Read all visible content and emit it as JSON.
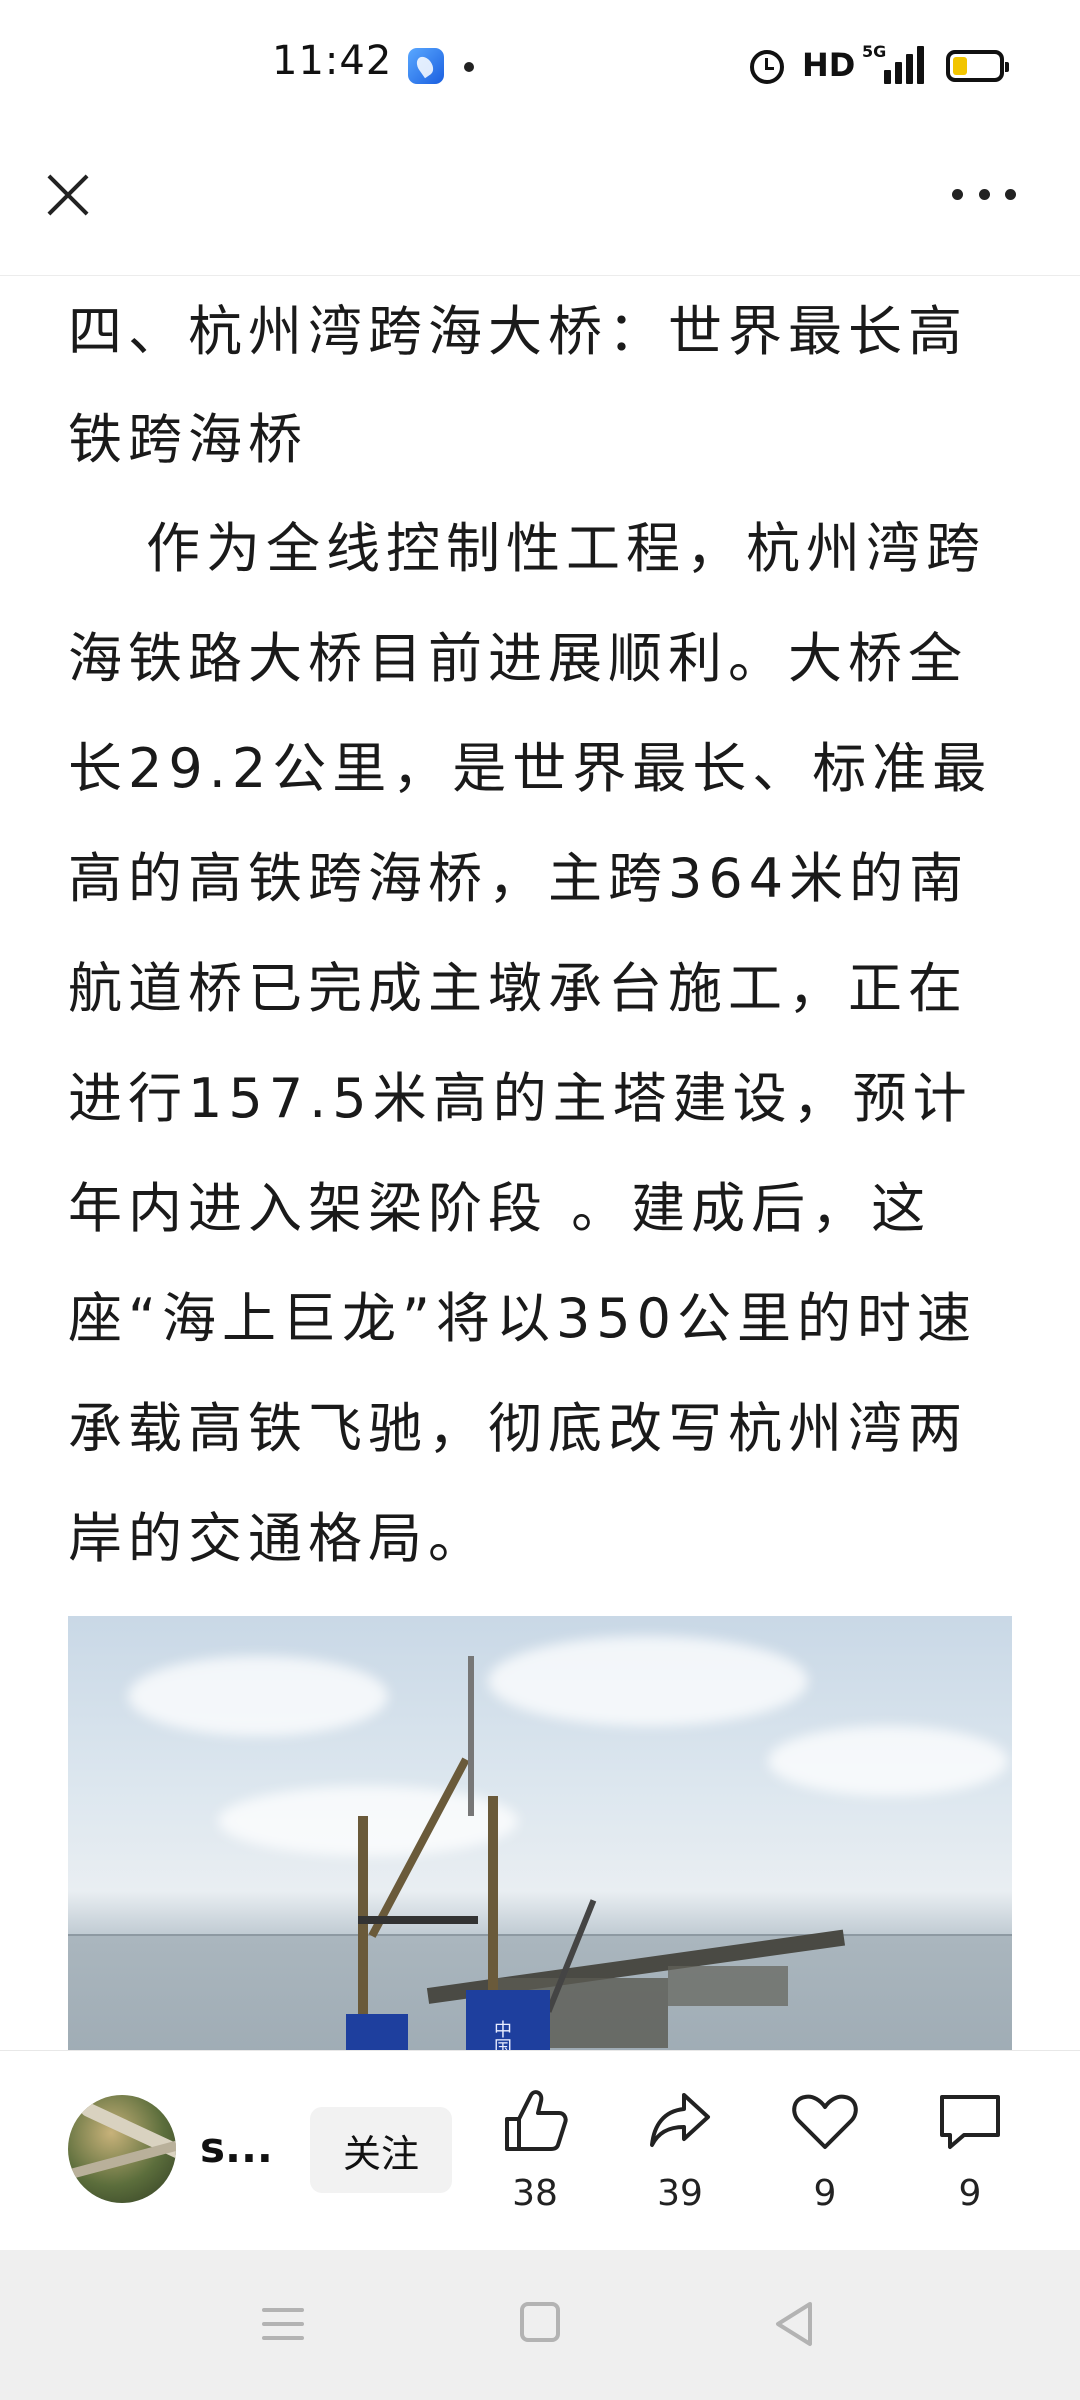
{
  "status_bar": {
    "time": "11:42",
    "network": "HD",
    "signal_label": "5G"
  },
  "top_bar": {
    "close_icon": "close-icon",
    "more_icon": "more-icon"
  },
  "article": {
    "headline": "四、杭州湾跨海大桥：世界最长高铁跨海桥",
    "body": "作为全线控制性工程，杭州湾跨海铁路大桥目前进展顺利。大桥全长29.2公里，是世界最长、标准最高的高铁跨海桥，主跨364米的南航道桥已完成主墩承台施工，正在进行157.5米高的主塔建设，预计年内进入架梁阶段 。建成后，这座“海上巨龙”将以350公里的时速承载高铁飞驰，彻底改写杭州湾两岸的交通格局。",
    "image_caption_text": "中国"
  },
  "action_bar": {
    "author_name": "s...",
    "follow_label": "关注",
    "like_count": "38",
    "share_count": "39",
    "favorite_count": "9",
    "comment_count": "9"
  },
  "colors": {
    "text": "#1a1a1a",
    "nav_bar_bg": "#efefef",
    "battery_fill": "#f2c500",
    "tower_blue": "#1e3f9e"
  }
}
